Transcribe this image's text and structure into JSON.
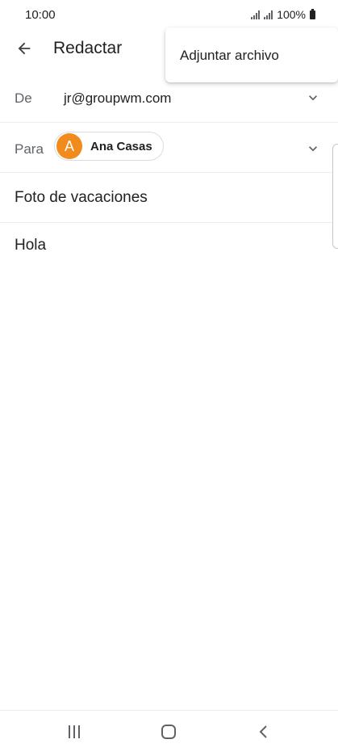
{
  "status_bar": {
    "time": "10:00",
    "battery": "100%"
  },
  "app_bar": {
    "title": "Redactar",
    "back_icon": "arrow-left-icon"
  },
  "overflow_menu": {
    "items": [
      {
        "label": "Adjuntar archivo"
      }
    ]
  },
  "compose": {
    "from": {
      "label": "De",
      "value": "jr@groupwm.com"
    },
    "to": {
      "label": "Para",
      "recipients": [
        {
          "initial": "A",
          "name": "Ana Casas",
          "avatar_color": "#f28b1e"
        }
      ]
    },
    "subject": "Foto de vacaciones",
    "body": "Hola"
  },
  "nav_bar": {
    "recent_icon": "recent-apps-icon",
    "home_icon": "home-icon",
    "back_icon": "back-icon"
  }
}
